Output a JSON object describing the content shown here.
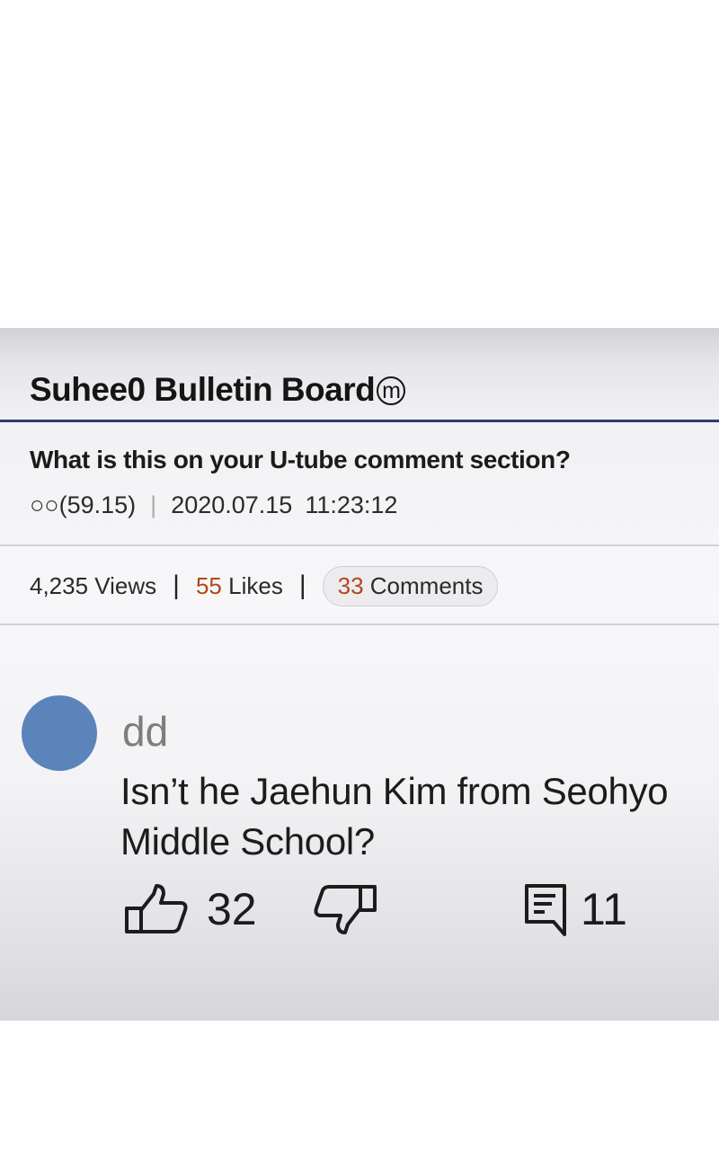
{
  "board": {
    "title": "Suhee0 Bulletin Board",
    "title_badge": "m"
  },
  "post": {
    "title": "What is this on your U-tube comment section?",
    "author": "○○(59.15)",
    "separator": "|",
    "date": "2020.07.15",
    "time": "11:23:12"
  },
  "stats": {
    "views": "4,235 Views",
    "likes_count": "55",
    "likes_label": "Likes",
    "comments_count": "33",
    "comments_label": "Comments",
    "separator": "|"
  },
  "comment": {
    "author": "dd",
    "text": "Isn’t he Jaehun Kim from Seohyo Middle School?",
    "avatar_color": "#5b84bb",
    "like_icon": "thumbs-up-icon",
    "like_count": "32",
    "dislike_icon": "thumbs-down-icon",
    "reply_icon": "reply-comment-icon",
    "reply_count": "11"
  },
  "colors": {
    "accent": "#b2471c",
    "rule": "#2d3b75"
  }
}
